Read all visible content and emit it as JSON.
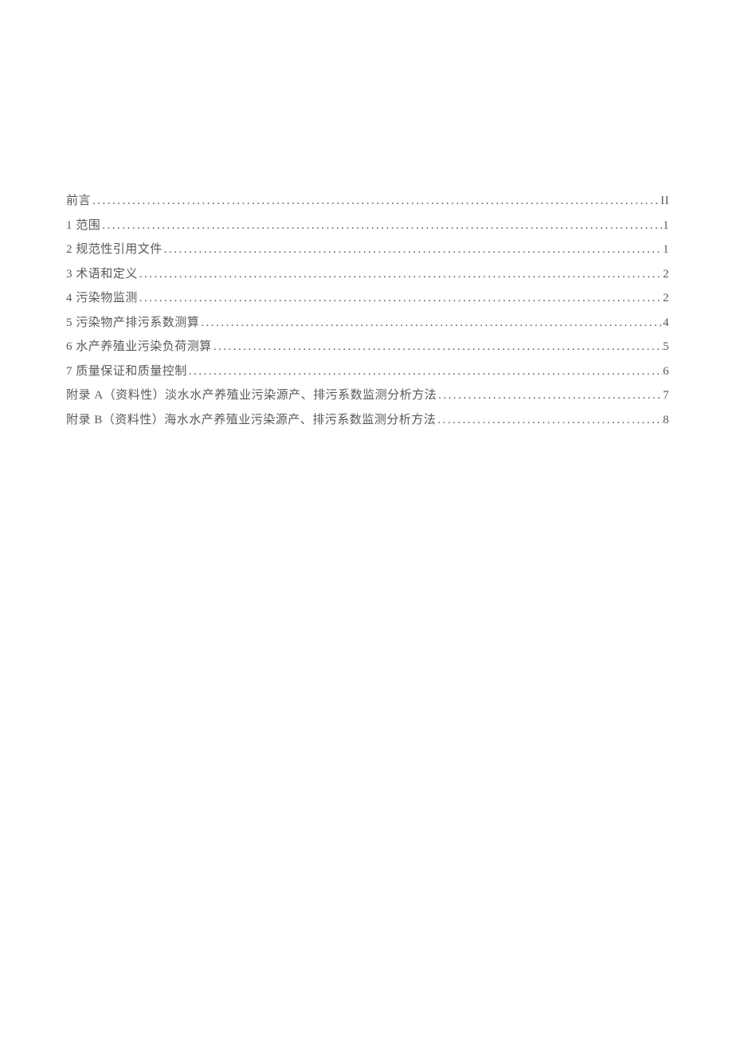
{
  "toc": [
    {
      "title": "前言",
      "page": "II"
    },
    {
      "title": "1 范围",
      "page": "1"
    },
    {
      "title": "2 规范性引用文件",
      "page": "1"
    },
    {
      "title": "3 术语和定义",
      "page": "2"
    },
    {
      "title": "4 污染物监测",
      "page": "2"
    },
    {
      "title": "5 污染物产排污系数测算",
      "page": "4"
    },
    {
      "title": "6 水产养殖业污染负荷测算",
      "page": "5"
    },
    {
      "title": "7 质量保证和质量控制",
      "page": "6"
    },
    {
      "title": "附录 A（资料性）淡水水产养殖业污染源产、排污系数监测分析方法",
      "page": "7"
    },
    {
      "title": "附录 B（资料性）海水水产养殖业污染源产、排污系数监测分析方法",
      "page": "8"
    }
  ]
}
